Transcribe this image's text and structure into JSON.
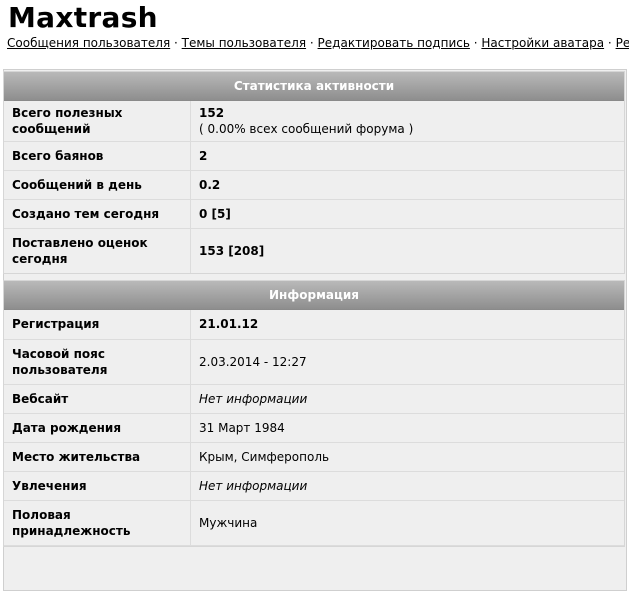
{
  "profile": {
    "username": "Maxtrash"
  },
  "nav": {
    "links": [
      "Сообщения пользователя",
      "Темы пользователя",
      "Редактировать подпись",
      "Настройки аватара",
      "Редактировать профиль"
    ],
    "separator": "·"
  },
  "activity": {
    "title": "Статистика активности",
    "rows": [
      {
        "label": "Всего полезных сообщений",
        "value": "152",
        "sub": "( 0.00% всех сообщений форума )"
      },
      {
        "label": "Всего баянов",
        "value": "2"
      },
      {
        "label": "Сообщений в день",
        "value": "0.2"
      },
      {
        "label": "Создано тем сегодня",
        "value": "0 [5]"
      },
      {
        "label": "Поставлено оценок сегодня",
        "value": "153 [208]"
      }
    ]
  },
  "info": {
    "title": "Информация",
    "rows": [
      {
        "label": "Регистрация",
        "value": "21.01.12"
      },
      {
        "label": "Часовой пояс пользователя",
        "value": "2.03.2014 - 12:27"
      },
      {
        "label": "Вебсайт",
        "value": "Нет информации"
      },
      {
        "label": "Дата рождения",
        "value": "31 Март 1984"
      },
      {
        "label": "Место жительства",
        "value": "Крым, Симферополь"
      },
      {
        "label": "Увлечения",
        "value": "Нет информации"
      },
      {
        "label": "Половая принадлежность",
        "value": "Мужчина"
      }
    ]
  }
}
